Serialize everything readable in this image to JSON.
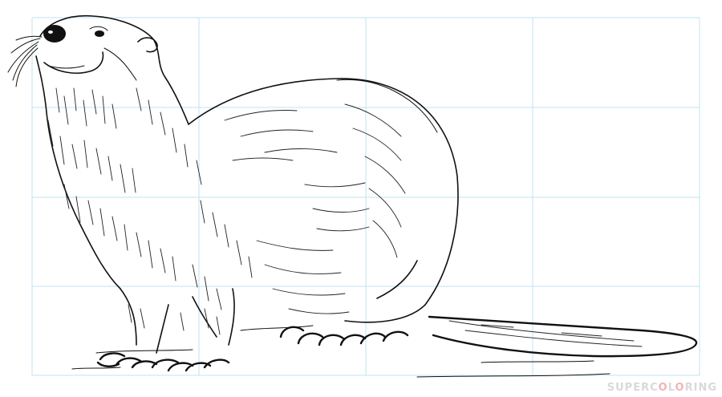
{
  "watermark": {
    "part1": "SUPERC",
    "o1": "O",
    "part2": "L",
    "o2": "O",
    "part3": "RING"
  }
}
